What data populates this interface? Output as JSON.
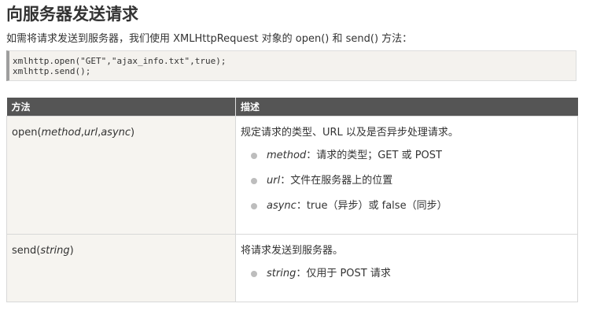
{
  "heading": "向服务器发送请求",
  "intro": "如需将请求发送到服务器，我们使用 XMLHttpRequest 对象的 open() 和 send() 方法：",
  "code": {
    "lines": [
      "xmlhttp.open(\"GET\",\"ajax_info.txt\",true);",
      "xmlhttp.send();"
    ]
  },
  "table": {
    "headers": {
      "method": "方法",
      "description": "描述"
    },
    "rows": [
      {
        "method": {
          "prefix": "open(",
          "args": [
            "method",
            "url",
            "async"
          ],
          "sep": ",",
          "suffix": ")"
        },
        "description": "规定请求的类型、URL 以及是否异步处理请求。",
        "params": [
          {
            "name": "method",
            "text": "：请求的类型；GET 或 POST"
          },
          {
            "name": "url",
            "text": "：文件在服务器上的位置"
          },
          {
            "name": "async",
            "text": "：true（异步）或 false（同步）"
          }
        ]
      },
      {
        "method": {
          "prefix": "send(",
          "args": [
            "string"
          ],
          "suffix": ")"
        },
        "description": "将请求发送到服务器。",
        "params": [
          {
            "name": "string",
            "text": "：仅用于 POST 请求"
          }
        ]
      }
    ]
  },
  "colors": {
    "header_bg": "#555555",
    "code_bg": "#f4f2ee",
    "bullet": "#bdbdbd"
  }
}
